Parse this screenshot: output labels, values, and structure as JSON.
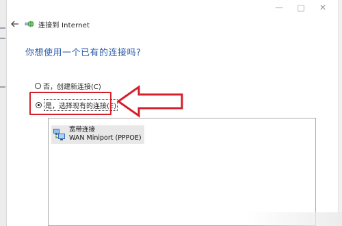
{
  "window": {
    "title": "连接到 Internet",
    "controls": {
      "minimize": "—",
      "maximize": "□",
      "close": "✕"
    }
  },
  "page": {
    "heading": "你想使用一个已有的连接吗?"
  },
  "options": [
    {
      "label": "否，创建新连接(C)",
      "checked": false
    },
    {
      "label": "是，选择现有的连接(E)",
      "checked": true
    }
  ],
  "connections": [
    {
      "name": "宽带连接",
      "device": "WAN Miniport (PPPOE)"
    }
  ],
  "colors": {
    "heading": "#2a5aa8",
    "highlight": "#d4202a",
    "selection": "#e8e8e8"
  },
  "icons": {
    "back": "back-arrow-icon",
    "app": "network-globe-icon",
    "connection": "network-computers-icon"
  }
}
